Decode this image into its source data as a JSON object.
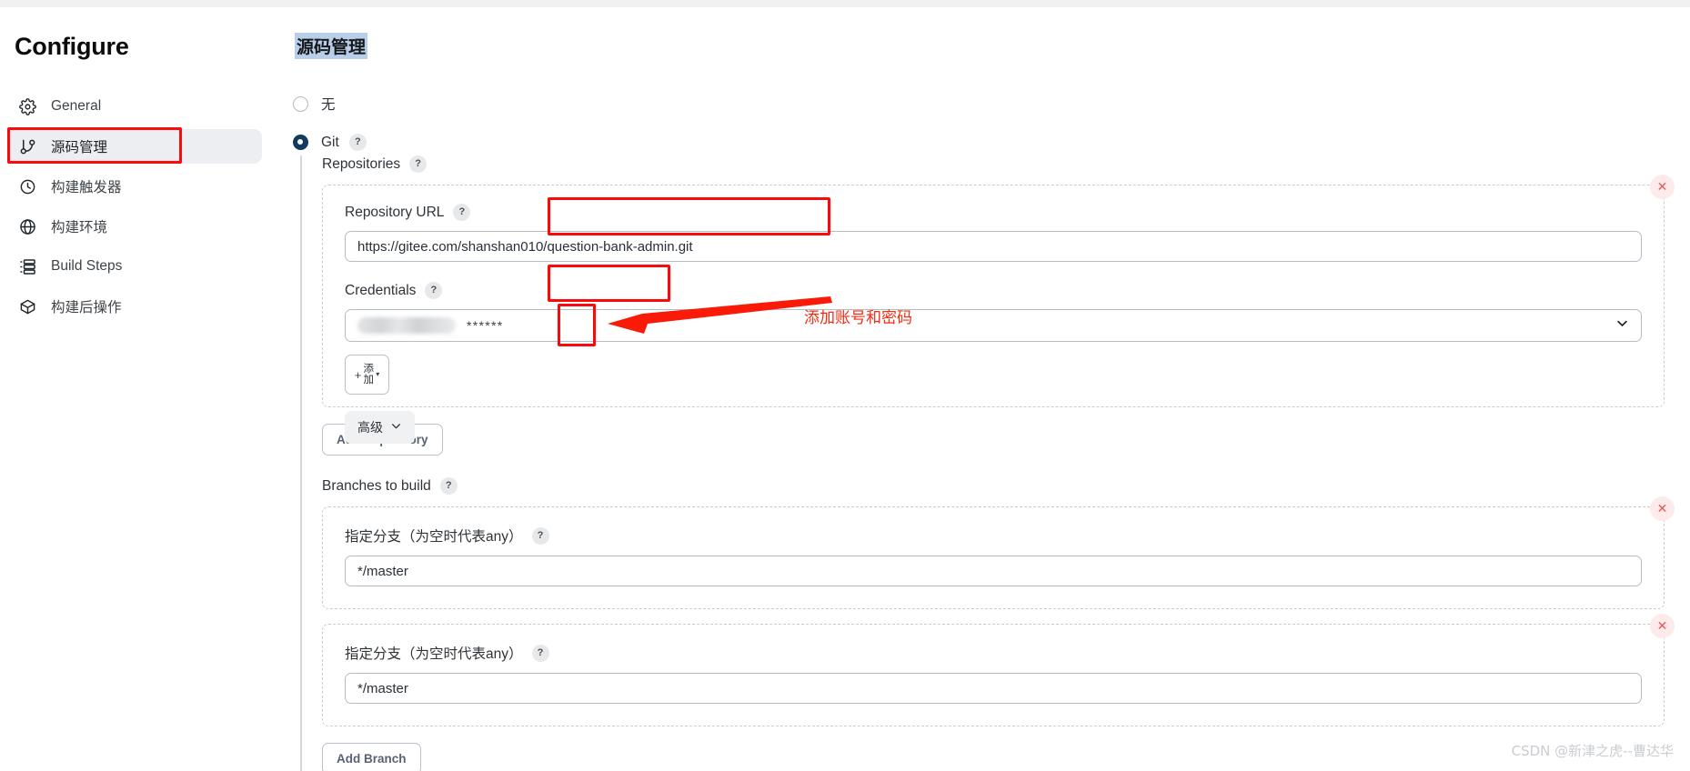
{
  "sidebar": {
    "title": "Configure",
    "items": [
      {
        "label": "General",
        "icon": "gear-icon",
        "active": false
      },
      {
        "label": "源码管理",
        "icon": "git-branch-icon",
        "active": true
      },
      {
        "label": "构建触发器",
        "icon": "clock-icon",
        "active": false
      },
      {
        "label": "构建环境",
        "icon": "globe-icon",
        "active": false
      },
      {
        "label": "Build Steps",
        "icon": "list-icon",
        "active": false
      },
      {
        "label": "构建后操作",
        "icon": "package-icon",
        "active": false
      }
    ]
  },
  "main": {
    "page_title": "源码管理",
    "scm_options": [
      {
        "label": "无",
        "selected": false
      },
      {
        "label": "Git",
        "selected": true,
        "help": "?"
      }
    ],
    "repositories": {
      "label": "Repositories",
      "help": "?",
      "repository_url": {
        "label": "Repository URL",
        "help": "?",
        "value": "https://gitee.com/shanshan010/question-bank-admin.git",
        "placeholder": ""
      },
      "credentials": {
        "label": "Credentials",
        "help": "?",
        "selected_value": "******",
        "masked": true,
        "add_button": {
          "plus": "+",
          "label_line1": "添",
          "label_line2": "加",
          "caret": "chevron-down-icon"
        }
      },
      "advanced_button": {
        "label": "高级",
        "caret": "chevron-down-icon"
      },
      "delete_icon": "close-icon"
    },
    "add_repository_button": "Add Repository",
    "branches": {
      "label": "Branches to build",
      "help": "?",
      "items": [
        {
          "label": "指定分支（为空时代表any）",
          "help": "?",
          "value": "*/master",
          "delete_icon": "close-icon"
        },
        {
          "label": "指定分支（为空时代表any）",
          "help": "?",
          "value": "*/master",
          "delete_icon": "close-icon"
        }
      ]
    },
    "add_branch_button": "Add Branch"
  },
  "annotations": {
    "add_credentials_note": "添加账号和密码",
    "highlight_color": "#fa0a0a",
    "note_color": "#fa2a12"
  },
  "watermark": "CSDN @新津之虎--曹达华"
}
